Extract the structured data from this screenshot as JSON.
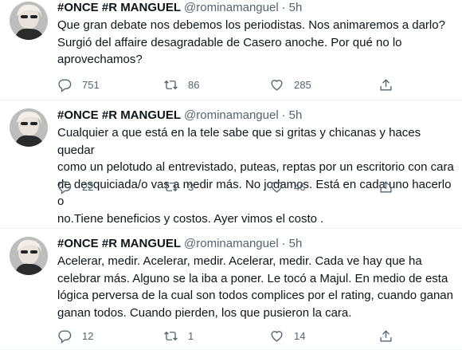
{
  "tweets": [
    {
      "name": "#ONCE #R MANGUEL",
      "handle": "@rominamanguel",
      "separator": "·",
      "time": "5h",
      "text": "Que gran debate nos debemos los periodistas. Nos animaremos a darlo?\nSurgió del affaire desagradable de Casero anoche. Por qué no lo\naprovechamos?",
      "replies": "751",
      "retweets": "86",
      "likes": "285"
    },
    {
      "name": "#ONCE #R MANGUEL",
      "handle": "@rominamanguel",
      "separator": "·",
      "time": "5h",
      "text": "Cualquier a que está en la tele sabe que si gritas y chicanas y haces quedar\ncomo un pelotudo al entrevistado, puteas, reptas por un escritorio con cara\nde desquiciada/o vas a medir más. No jodamos. Está en cada uno hacerlo o\nno.Tiene beneficios y costos. Ayer vimos el costo .",
      "replies": "22",
      "retweets": "3",
      "likes": "46"
    },
    {
      "name": "#ONCE #R MANGUEL",
      "handle": "@rominamanguel",
      "separator": "·",
      "time": "5h",
      "text": "Acelerar, medir. Acelerar, medir. Acelerar, medir. Cada ve hay que ha\ncelebrar más. Alguno se la iba a poner. Le tocó a Majul. En medio de esta\nlógica perversa de la cual son todos complices por el rating, cuando ganan\nganan todos. Cuando pierden, los que pusieron la cara.",
      "replies": "12",
      "retweets": "1",
      "likes": "14"
    }
  ],
  "icons": {
    "reply": "reply-icon",
    "retweet": "retweet-icon",
    "like": "like-icon",
    "share": "share-icon"
  },
  "colors": {
    "text": "#0f1419",
    "secondary": "#536471",
    "divider": "#eff3f4"
  }
}
